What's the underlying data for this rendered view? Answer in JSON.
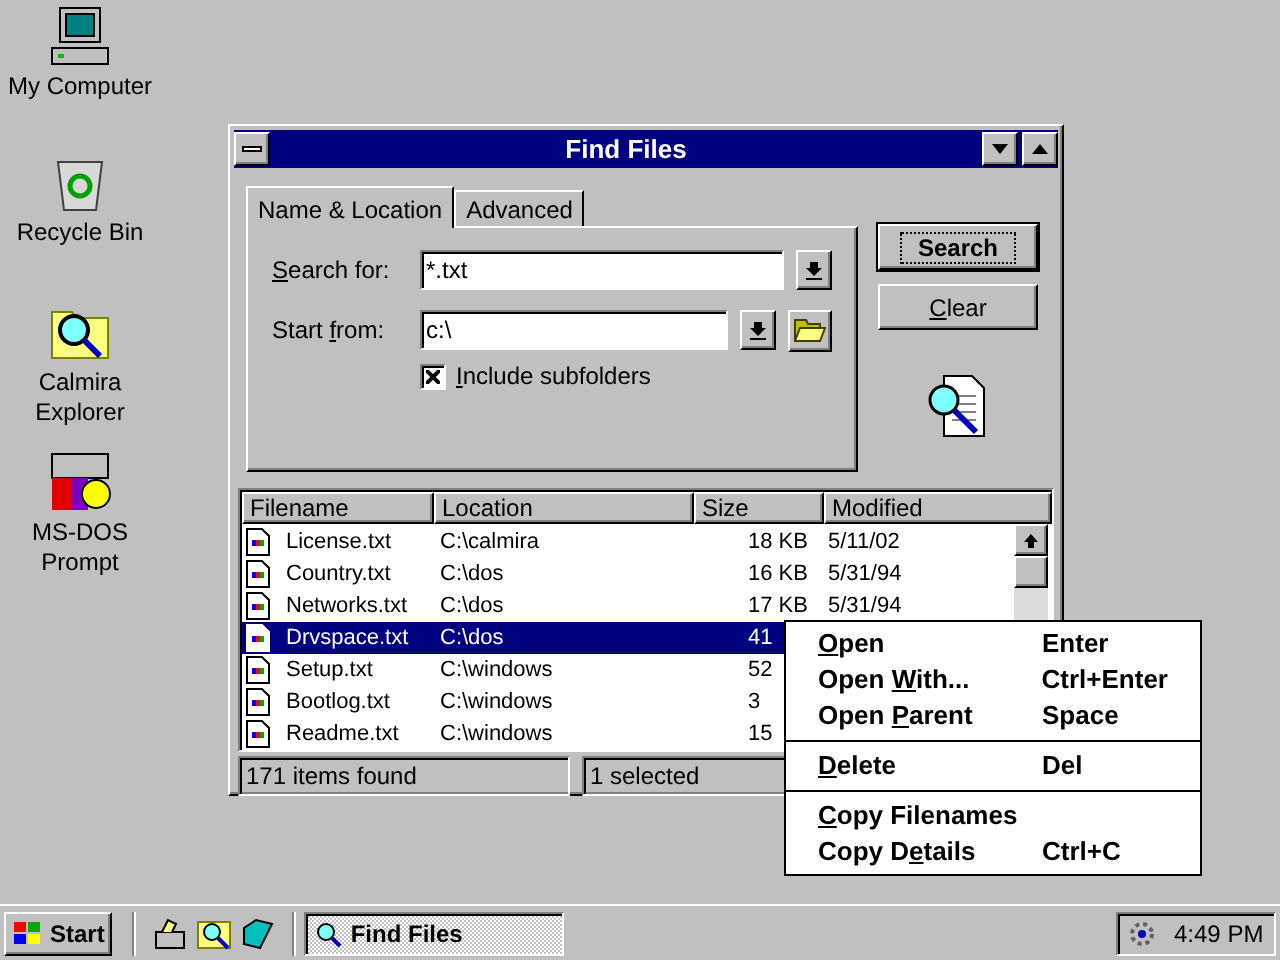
{
  "desktop_icons": [
    {
      "kind": "computer",
      "label": "My Computer"
    },
    {
      "kind": "bin",
      "label": "Recycle Bin"
    },
    {
      "kind": "explorer",
      "label": "Calmira Explorer"
    },
    {
      "kind": "dos",
      "label": "MS-DOS Prompt"
    }
  ],
  "window": {
    "title": "Find Files",
    "tabs": [
      {
        "label": "Name & Location",
        "selected": true
      },
      {
        "label": "Advanced",
        "selected": false
      }
    ],
    "search_for": {
      "label": {
        "key": "S",
        "post": "earch for:"
      },
      "value": "*.txt"
    },
    "start_from": {
      "label": {
        "pre": "Start ",
        "key": "f",
        "post": "rom:"
      },
      "value": "c:\\"
    },
    "include_subfolders": {
      "label": {
        "key": "I",
        "post": "nclude subfolders"
      },
      "checked": true
    },
    "buttons": [
      {
        "label": {
          "post": "Search"
        },
        "default": true
      },
      {
        "label": {
          "key": "C",
          "post": "lear"
        },
        "default": false
      }
    ],
    "table": {
      "columns": [
        "Filename",
        "Location",
        "Size",
        "Modified"
      ],
      "rows": [
        {
          "filename": "License.txt",
          "location": "C:\\calmira",
          "size": "18 KB",
          "modified": "5/11/02",
          "selected": false
        },
        {
          "filename": "Country.txt",
          "location": "C:\\dos",
          "size": "16 KB",
          "modified": "5/31/94",
          "selected": false
        },
        {
          "filename": "Networks.txt",
          "location": "C:\\dos",
          "size": "17 KB",
          "modified": "5/31/94",
          "selected": false
        },
        {
          "filename": "Drvspace.txt",
          "location": "C:\\dos",
          "size": "41",
          "selected": true
        },
        {
          "filename": "Setup.txt",
          "location": "C:\\windows",
          "size": "52",
          "selected": false
        },
        {
          "filename": "Bootlog.txt",
          "location": "C:\\windows",
          "size": "3",
          "selected": false
        },
        {
          "filename": "Readme.txt",
          "location": "C:\\windows",
          "size": "15",
          "selected": false
        }
      ]
    },
    "status_bar": [
      "171 items found",
      "1 selected"
    ]
  },
  "context_menu": [
    {
      "kind": "item",
      "label": {
        "key": "O",
        "post": "pen"
      },
      "shortcut": "Enter"
    },
    {
      "kind": "item",
      "label": {
        "pre": "Open ",
        "key": "W",
        "post": "ith..."
      },
      "shortcut": "Ctrl+Enter"
    },
    {
      "kind": "item",
      "label": {
        "pre": "Open ",
        "key": "P",
        "post": "arent"
      },
      "shortcut": "Space"
    },
    {
      "kind": "separator"
    },
    {
      "kind": "item",
      "label": {
        "key": "D",
        "post": "elete"
      },
      "shortcut": "Del"
    },
    {
      "kind": "separator"
    },
    {
      "kind": "item",
      "label": {
        "key": "C",
        "post": "opy Filenames"
      }
    },
    {
      "kind": "item",
      "label": {
        "pre": "Copy D",
        "key": "e",
        "post": "tails"
      },
      "shortcut": "Ctrl+C"
    }
  ],
  "taskbar": {
    "start": "Start",
    "quick_launch": [
      {
        "kind": "desk"
      },
      {
        "kind": "find"
      },
      {
        "kind": "book"
      }
    ],
    "tasks": [
      {
        "label": "Find Files",
        "selected": true
      }
    ],
    "clock": "4:49 PM"
  }
}
